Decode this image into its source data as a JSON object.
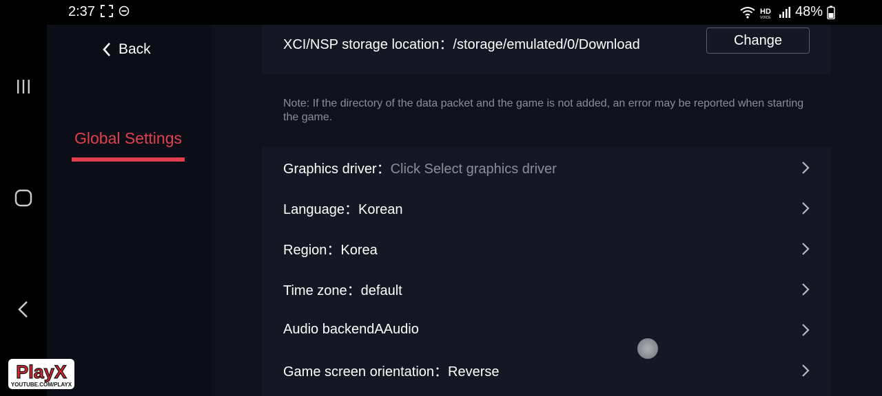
{
  "status_bar": {
    "time": "2:37",
    "battery": "48%",
    "icons": [
      "screenshot-frame-icon",
      "do-not-disturb-icon",
      "wifi-icon",
      "hd-voice-icon",
      "signal-icon",
      "battery-icon"
    ]
  },
  "system_nav": {
    "recent": "recent-apps-icon",
    "home": "home-icon",
    "back": "back-icon"
  },
  "sidebar": {
    "back_label": "Back",
    "active_item": "Global Settings"
  },
  "storage": {
    "label": "XCI/NSP storage location：",
    "value": "/storage/emulated/0/Download",
    "change_label": "Change"
  },
  "note": "Note: If the directory of the data packet and the game is not added, an error may be reported when starting the game.",
  "settings": [
    {
      "label": "Graphics driver：",
      "value": "Click Select graphics driver",
      "placeholder": true
    },
    {
      "label": "Language：",
      "value": "Korean",
      "placeholder": false
    },
    {
      "label": "Region：",
      "value": "Korea",
      "placeholder": false
    },
    {
      "label": "Time zone：",
      "value": "default",
      "placeholder": false
    },
    {
      "label": "Audio backend",
      "value": "AAudio",
      "placeholder": false
    },
    {
      "label": "Game screen orientation：",
      "value": "Reverse",
      "placeholder": false
    }
  ],
  "watermark": {
    "brand": "PlayX",
    "subtitle": "YOUTUBE.COM/PLAYX"
  },
  "colors": {
    "accent": "#e3404f",
    "background": "#10121b",
    "card": "#151824",
    "sidebar": "#0c0e17",
    "muted_text": "#8a8e99"
  }
}
